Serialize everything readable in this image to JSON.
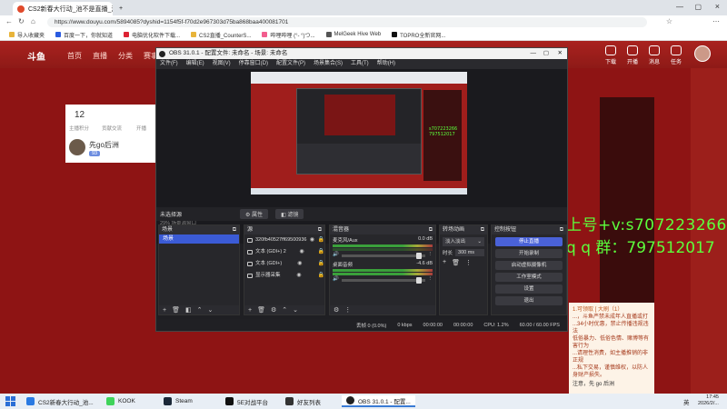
{
  "browser": {
    "tabs": [
      {
        "label": "CS2新春大行动_池不是直播_池不...",
        "active": true
      },
      {
        "label": "",
        "active": false
      }
    ],
    "url": "https://www.douyu.com/5894085?dyshid=1154f5f-f70d2e967303d75ba868baa400081701",
    "bookmarks": [
      "导入收藏夹",
      "百度一下，你就知道",
      "电脑优化软件下载...",
      "CS2直播_CounterS...",
      "哔哩哔哩 (°- °)つ...",
      "MelGeek Hive Web",
      "TOPRO全新官网..."
    ]
  },
  "douyu": {
    "logo": "斗鱼",
    "nav": [
      "首页",
      "直播",
      "分类",
      "赛事"
    ],
    "header_icons": [
      "下载",
      "开播",
      "消息",
      "任务"
    ],
    "stream_stats": [
      {
        "value": "12",
        "label": "主播积分"
      },
      {
        "value": "",
        "label": "贡献交流"
      },
      {
        "value": "",
        "label": "开播"
      }
    ],
    "streamer_name": "先go后洲",
    "streamer_badge": "93",
    "overlay_line1": "上号+v:s707223266",
    "overlay_line2": "q q 群：797512017",
    "chat_lines": [
      "1.可领取 [ 大刷（1）",
      "...，斗鱼严禁未成年人直播或打",
      "...34小时优惠，禁止传播违规违法",
      "低俗暴力、低俗色情、赌博等有害行为",
      "...请理性消费，如主播推销的非正规",
      "...私下交易，谨慎维权，以防人身财产损失。"
    ],
    "chat_notice": "注意，先 go 后洲"
  },
  "obs": {
    "title": "OBS 31.0.1 - 配置文件: 未命名 - 场景: 未命名",
    "menu": [
      "文件(F)",
      "编辑(E)",
      "视图(V)",
      "停靠窗口(D)",
      "配置文件(P)",
      "场景集合(S)",
      "工具(T)",
      "帮助(H)"
    ],
    "zoom_label": "29%  场景源窗口",
    "scene_bar": {
      "selected": "未选择源",
      "properties": "属性",
      "filters": "滤镜"
    },
    "docks": {
      "scenes": {
        "title": "场景",
        "items": [
          "场景"
        ]
      },
      "sources": {
        "title": "源",
        "items": [
          "320fb40527ff69500936",
          "文本 (GDI+) 2",
          "文本 (GDI+)",
          "显示器采集"
        ]
      },
      "mixer": {
        "title": "混音器",
        "channels": [
          {
            "name": "麦克风/Aux",
            "db": "0.0 dB"
          },
          {
            "name": "桌面音频",
            "db": "-4.6 dB"
          }
        ]
      },
      "transitions": {
        "title": "转场动画",
        "type": "淡入淡出",
        "duration_label": "时长",
        "duration": "300 ms"
      },
      "controls": {
        "title": "控制按钮",
        "buttons": [
          "停止直播",
          "开始录制",
          "启动虚拟摄像机",
          "工作室模式",
          "设置",
          "退出"
        ]
      }
    },
    "status": {
      "dropped": "丢帧 0 (0.0%)",
      "bitrate": "0 kbps",
      "stream_time": "00:00:00",
      "rec_time": "00:00:00",
      "cpu": "CPU: 1.2%",
      "fps": "60.00 / 60.00 FPS"
    }
  },
  "taskbar": {
    "items": [
      "CS2新春大行动_池...",
      "KOOK",
      "Steam",
      "5E对战平台",
      "好友列表",
      "OBS 31.0.1 - 配置..."
    ],
    "lang": "英",
    "time": "17:45",
    "date": "2026/2/..."
  },
  "colors": {
    "douyu_red": "#8e1414",
    "overlay_green": "#5cff3c",
    "obs_accent": "#4a62d8"
  }
}
